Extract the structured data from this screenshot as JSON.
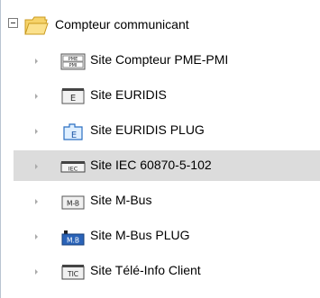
{
  "tree": {
    "root": {
      "label": "Compteur communicant",
      "expanded": true,
      "icon": "folder-icon"
    },
    "children": [
      {
        "label": "Site Compteur PME-PMI",
        "icon": "pme-pmi-meter-icon",
        "icon_text": "PME PMI",
        "selected": false
      },
      {
        "label": "Site EURIDIS",
        "icon": "euridis-icon",
        "icon_text": "E",
        "selected": false
      },
      {
        "label": "Site EURIDIS PLUG",
        "icon": "euridis-plug-icon",
        "icon_text": "E",
        "selected": false
      },
      {
        "label": "Site IEC 60870-5-102",
        "icon": "iec-icon",
        "icon_text": "IEC",
        "selected": true
      },
      {
        "label": "Site M-Bus",
        "icon": "mbus-icon",
        "icon_text": "M-B",
        "selected": false
      },
      {
        "label": "Site M-Bus PLUG",
        "icon": "mbus-plug-icon",
        "icon_text": "M.B",
        "selected": false
      },
      {
        "label": "Site Télé-Info Client",
        "icon": "teleinfo-icon",
        "icon_text": "TIC",
        "selected": false
      }
    ]
  }
}
